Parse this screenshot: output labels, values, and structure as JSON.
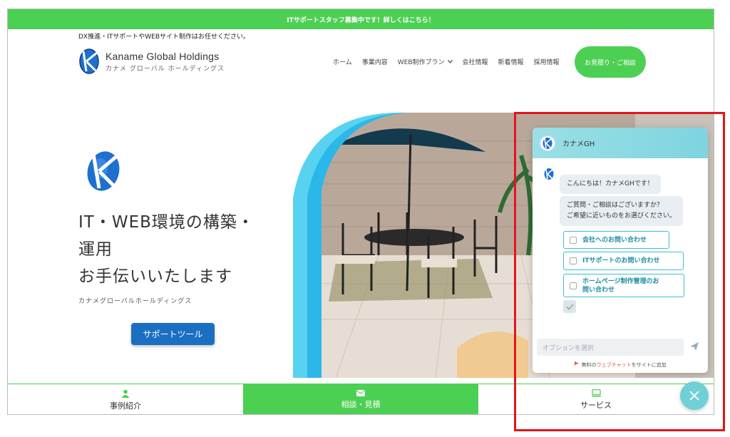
{
  "announcement": "ITサポートスタッフ募集中です！詳しくはこちら！",
  "tagline": "DX推進・ITサポートやWEBサイト制作はお任せください。",
  "logo": {
    "name_en": "Kaname Global Holdings",
    "name_ja": "カナメ グローバル ホールディングス"
  },
  "nav": {
    "items": [
      {
        "label": "ホーム"
      },
      {
        "label": "事業内容"
      },
      {
        "label": "WEB制作プラン",
        "icon": "chevron-down-icon"
      },
      {
        "label": "会社情報"
      },
      {
        "label": "新着情報"
      },
      {
        "label": "採用情報"
      }
    ],
    "cta": "お見積り・ご相談"
  },
  "hero": {
    "title_line1": "IT・WEB環境の構築・",
    "title_line2": "運用",
    "title_line3": "お手伝いいたします",
    "subtitle": "カナメグローバルホールディングス",
    "button": "サポートツール"
  },
  "bottom_nav": [
    {
      "label": "事例紹介",
      "icon": "person-icon"
    },
    {
      "label": "相談・見積",
      "icon": "mail-icon"
    },
    {
      "label": "サービス",
      "icon": "monitor-icon"
    }
  ],
  "chat": {
    "name": "カナメGH",
    "greeting": "こんにちは！カナメGHです！",
    "prompt_line1": "ご質問・ご相談はございますか？",
    "prompt_line2": "ご希望に近いものをお選びください。",
    "options": [
      {
        "label": "会社へのお問い合わせ"
      },
      {
        "label": "ITサポートのお問い合わせ"
      },
      {
        "label_line1": "ホームページ制作管理のお",
        "label_line2": "問い合わせ"
      }
    ],
    "input_placeholder": "オプションを選択",
    "powered_prefix": "無料の",
    "powered_brand": "ウェブチャット",
    "powered_suffix": "をサイトに追加"
  },
  "colors": {
    "brand_green": "#4cd053",
    "chat_teal": "#7fd4df",
    "button_blue": "#1b6fc2",
    "highlight_red": "#e6141b"
  }
}
